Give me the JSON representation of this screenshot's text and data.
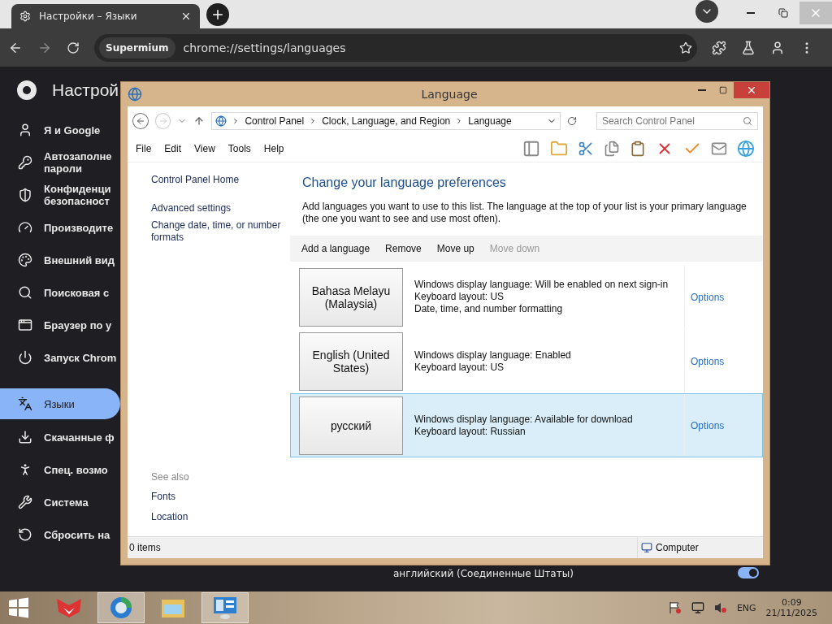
{
  "browser": {
    "tab_title": "Настройки – Языки",
    "site_chip": "Supermium",
    "url": "chrome://settings/languages"
  },
  "settings": {
    "title": "Настрой",
    "nav": [
      {
        "lines": [
          "Я и Google"
        ],
        "selected": false
      },
      {
        "lines": [
          "Автозаполне",
          "пароли"
        ],
        "selected": false
      },
      {
        "lines": [
          "Конфиденци",
          "безопасност"
        ],
        "selected": false
      },
      {
        "lines": [
          "Производите"
        ],
        "selected": false
      },
      {
        "lines": [
          "Внешний вид"
        ],
        "selected": false
      },
      {
        "lines": [
          "Поисковая с"
        ],
        "selected": false
      },
      {
        "lines": [
          "Браузер по у"
        ],
        "selected": false
      },
      {
        "lines": [
          "Запуск Chrom"
        ],
        "selected": false
      },
      {
        "lines": [
          "Языки"
        ],
        "selected": true
      },
      {
        "lines": [
          "Скачанные ф"
        ],
        "selected": false
      },
      {
        "lines": [
          "Спец. возмо"
        ],
        "selected": false
      },
      {
        "lines": [
          "Система"
        ],
        "selected": false
      },
      {
        "lines": [
          "Сбросить на"
        ],
        "selected": false
      }
    ],
    "row": {
      "label": "английский (Соединенные Штаты)",
      "on": true
    }
  },
  "window": {
    "title": "Language",
    "breadcrumb": [
      "Control Panel",
      "Clock, Language, and Region",
      "Language"
    ],
    "search": {
      "placeholder": "Search Control Panel"
    },
    "menu": [
      "File",
      "Edit",
      "View",
      "Tools",
      "Help"
    ],
    "left_links": [
      "Control Panel Home",
      "Advanced settings",
      "Change date, time, or number formats"
    ],
    "heading": "Change your language preferences",
    "description": "Add languages you want to use to this list. The language at the top of your list is your primary language (the one you want to see and use most often).",
    "actions": [
      {
        "label": "Add a language",
        "disabled": false
      },
      {
        "label": "Remove",
        "disabled": false
      },
      {
        "label": "Move up",
        "disabled": false
      },
      {
        "label": "Move down",
        "disabled": true
      }
    ],
    "languages": [
      {
        "name": "Bahasa Melayu (Malaysia)",
        "details": [
          "Windows display language: Will be enabled on next sign-in",
          "Keyboard layout: US",
          "Date, time, and number formatting"
        ],
        "options": "Options",
        "selected": false
      },
      {
        "name": "English (United States)",
        "details": [
          "Windows display language: Enabled",
          "Keyboard layout: US"
        ],
        "options": "Options",
        "selected": false
      },
      {
        "name": "русский",
        "details": [
          "Windows display language: Available for download",
          "Keyboard layout: Russian"
        ],
        "options": "Options",
        "selected": true
      }
    ],
    "see_also": {
      "title": "See also",
      "links": [
        "Fonts",
        "Location"
      ]
    },
    "status_bar": {
      "items": "0 items",
      "zone": "Computer"
    }
  },
  "taskbar": {
    "apps": [
      {
        "selected": false
      },
      {
        "selected": true
      },
      {
        "selected": false
      },
      {
        "selected": true
      }
    ],
    "language": "ENG",
    "time": "0:09",
    "date": "21/11/2025"
  }
}
